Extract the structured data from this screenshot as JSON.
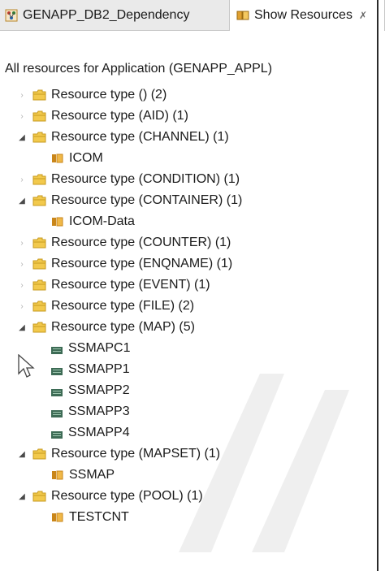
{
  "tabs": [
    {
      "label": "GENAPP_DB2_Dependency",
      "icon": "graph-editor-icon"
    },
    {
      "label": "Show Resources",
      "icon": "resources-view-icon",
      "close": "✗"
    }
  ],
  "heading": "All resources for Application (GENAPP_APPL)",
  "tree": [
    {
      "label": "Resource type ()  (2)",
      "expanded": false
    },
    {
      "label": "Resource type (AID)  (1)",
      "expanded": false
    },
    {
      "label": "Resource type (CHANNEL)  (1)",
      "expanded": true
    },
    {
      "label": "ICOM",
      "child": true,
      "icon": "resource-icon"
    },
    {
      "label": "Resource type (CONDITION)  (1)",
      "expanded": false
    },
    {
      "label": "Resource type (CONTAINER)  (1)",
      "expanded": true
    },
    {
      "label": "ICOM-Data",
      "child": true,
      "icon": "resource-icon"
    },
    {
      "label": "Resource type (COUNTER)  (1)",
      "expanded": false
    },
    {
      "label": "Resource type (ENQNAME)  (1)",
      "expanded": false
    },
    {
      "label": "Resource type (EVENT)  (1)",
      "expanded": false
    },
    {
      "label": "Resource type (FILE)  (2)",
      "expanded": false
    },
    {
      "label": "Resource type (MAP)  (5)",
      "expanded": true
    },
    {
      "label": "SSMAPC1",
      "child": true,
      "icon": "map-icon"
    },
    {
      "label": "SSMAPP1",
      "child": true,
      "icon": "map-icon"
    },
    {
      "label": "SSMAPP2",
      "child": true,
      "icon": "map-icon"
    },
    {
      "label": "SSMAPP3",
      "child": true,
      "icon": "map-icon"
    },
    {
      "label": "SSMAPP4",
      "child": true,
      "icon": "map-icon"
    },
    {
      "label": "Resource type (MAPSET)  (1)",
      "expanded": true
    },
    {
      "label": "SSMAP",
      "child": true,
      "icon": "resource-icon"
    },
    {
      "label": "Resource type (POOL)  (1)",
      "expanded": true
    },
    {
      "label": "TESTCNT",
      "child": true,
      "icon": "resource-icon"
    }
  ],
  "colors": {
    "folder_fill": "#f2c94c",
    "folder_edge": "#c79a1e",
    "resource_icon": "#c9861a",
    "map_icon": "#3d6b55"
  }
}
